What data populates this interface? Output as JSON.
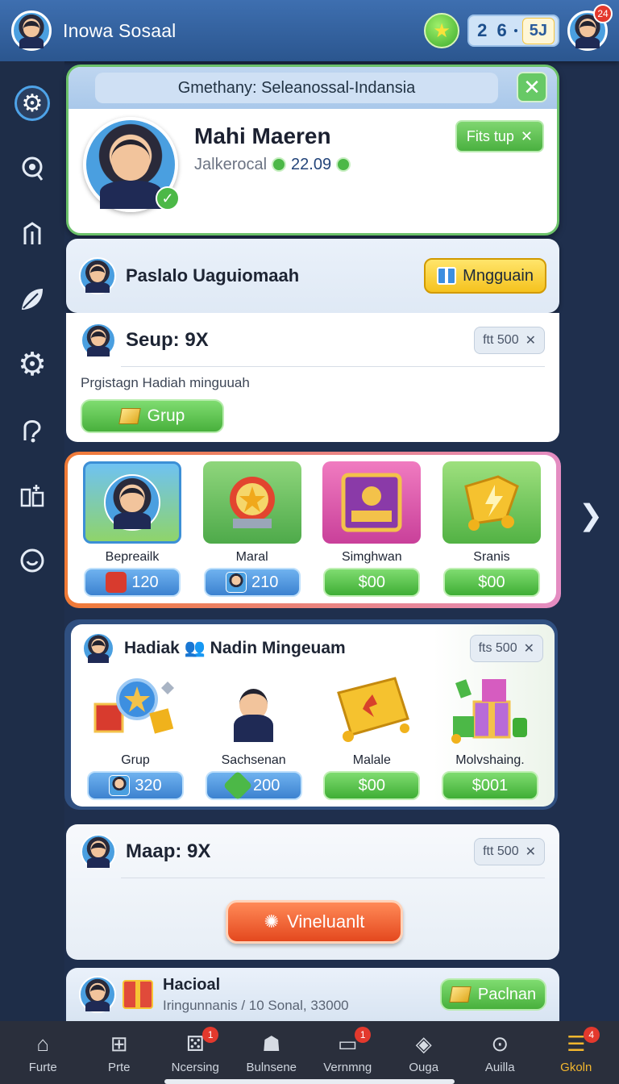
{
  "header": {
    "app_title": "Inowa Sosaal",
    "counter_value": "2 6",
    "counter_badge": "5J",
    "notification_count": "24"
  },
  "sidebar": {
    "items": [
      {
        "icon": "gear-icon",
        "active": true
      },
      {
        "icon": "eye-icon"
      },
      {
        "icon": "upload-icon"
      },
      {
        "icon": "leaf-icon"
      },
      {
        "icon": "settings-icon"
      },
      {
        "icon": "hook-icon"
      },
      {
        "icon": "apps-icon"
      },
      {
        "icon": "smile-icon"
      }
    ]
  },
  "profile_card": {
    "strip_text": "Gmethany: Seleanossal-Indansia",
    "name": "Mahi Maeren",
    "subtitle": "Jalkerocal",
    "score": "22.09",
    "follow_label": "Fits tup"
  },
  "group_row": {
    "title": "Paslalo Uaguiomaah",
    "button_label": "Mngguain"
  },
  "setup_card": {
    "title": "Seup: 9X",
    "chip_label": "ftt 500",
    "description": "Prgistagn Hadiah minguuah",
    "group_button": "Grup"
  },
  "featured_items": [
    {
      "label": "Bepreailk",
      "price": "120",
      "style": "blue"
    },
    {
      "label": "Maral",
      "price": "210",
      "style": "blue"
    },
    {
      "label": "Simghwan",
      "price": "$00",
      "style": "green"
    },
    {
      "label": "Sranis",
      "price": "$00",
      "style": "green"
    }
  ],
  "weekly_card": {
    "title": "Hadiak 👥 Nadin Mingeuam",
    "chip_label": "fts 500",
    "items": [
      {
        "label": "Grup",
        "price": "320",
        "style": "blue"
      },
      {
        "label": "Sachsenan",
        "price": "200",
        "style": "blue"
      },
      {
        "label": "Malale",
        "price": "$00",
        "style": "green"
      },
      {
        "label": "Molvshaing.",
        "price": "$001",
        "style": "green"
      }
    ]
  },
  "map_card": {
    "title": "Maap: 9X",
    "chip_label": "ftt 500",
    "action_label": "Vineluanlt"
  },
  "social_card": {
    "title": "Hacioal",
    "subtitle": "Iringunnanis / 10 Sonal, 33000",
    "button_label": "Paclnan"
  },
  "bottom_nav": [
    {
      "label": "Furte",
      "icon": "home-icon"
    },
    {
      "label": "Prte",
      "icon": "add-home-icon"
    },
    {
      "label": "Ncersing",
      "icon": "dice-icon",
      "badge": "1"
    },
    {
      "label": "Bulnsene",
      "icon": "group-icon"
    },
    {
      "label": "Vernmng",
      "icon": "screen-icon",
      "badge": "1"
    },
    {
      "label": "Ouga",
      "icon": "tag-icon"
    },
    {
      "label": "Auilla",
      "icon": "search-icon"
    },
    {
      "label": "Gkoln",
      "icon": "menu-icon",
      "badge": "4",
      "active": true
    }
  ],
  "colors": {
    "topbar": "#3e6fb0",
    "sidebar": "#1e2d48",
    "accent_green": "#4cb847",
    "accent_orange": "#e4481e",
    "accent_yellow": "#f5c21e"
  }
}
